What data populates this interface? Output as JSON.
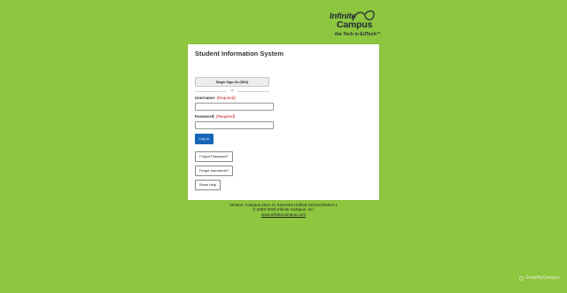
{
  "logo": {
    "brand_line1": "Infinite",
    "brand_line2": "Campus",
    "tagline": "the Tech in EdTech™"
  },
  "card": {
    "title": "Student Information System",
    "sso_label": "Single Sign-On (SSO)",
    "or_text": "or",
    "username_label": "Username:",
    "password_label": "Password:",
    "required_text": "(Required)",
    "username_value": "",
    "password_value": "",
    "login_label": "Log In",
    "forgot_password_label": "Forgot Password?",
    "forgot_username_label": "Forgot Username?",
    "show_help_label": "Show Help"
  },
  "footer": {
    "version": "Version: Campus.2511.3 | Kenosha Unified School District 1",
    "copyright": "© 2003-2026 Infinite Campus, Inc.",
    "link": "www.infinitecampus.com"
  },
  "watermark": {
    "text": "SnapMyCampus"
  },
  "colors": {
    "background": "#8dc63f",
    "primary_button": "#1565b8",
    "required": "#c0141c"
  }
}
